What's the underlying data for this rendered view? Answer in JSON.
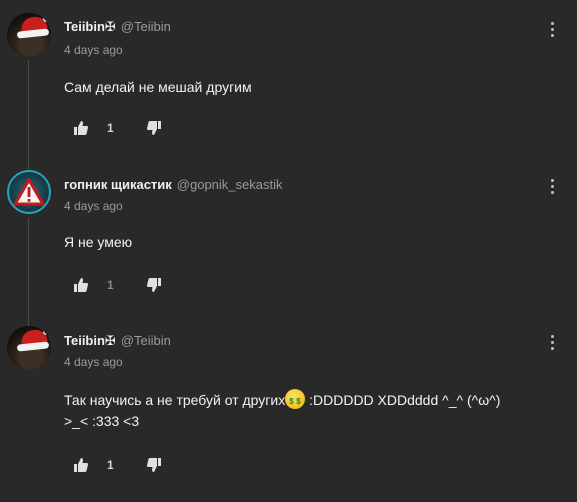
{
  "comments": [
    {
      "avatar": "santa-hat-avatar",
      "author": "Teiibin✠",
      "handle": "@Teiibin",
      "time": "4 days ago",
      "text": "Сам делай не мешай другим",
      "likes": "1"
    },
    {
      "avatar": "warning-sign-avatar",
      "author": "гопник щикастик",
      "handle": "@gopnik_sekastik",
      "time": "4 days ago",
      "text": "Я не умею",
      "likes": "1"
    },
    {
      "avatar": "santa-hat-avatar",
      "author": "Teiibin✠",
      "handle": "@Teiibin",
      "time": "4 days ago",
      "text_part1": "Так научись а не требуй от других",
      "emoji": "money-mouth-face",
      "text_part2": " :DDDDDD XDDdddd ^_^ (^ω^)",
      "text_line2": ">_< :333 <3",
      "likes": "1"
    }
  ],
  "icons": {
    "like": "thumbs-up-icon",
    "dislike": "thumbs-down-icon",
    "menu": "more-vertical-icon"
  },
  "colors": {
    "background": "#292929",
    "text": "#f2f2f2",
    "muted": "#9a9a9a",
    "avatar_ring": "#2aa3b8"
  }
}
